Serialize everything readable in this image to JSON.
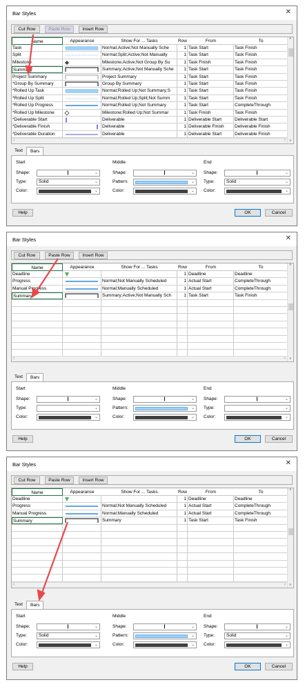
{
  "dialogs": [
    {
      "title": "Bar Styles",
      "toolbar": {
        "cut": "Cut Row",
        "paste": "Paste Row",
        "insert": "Insert Row",
        "paste_disabled": true
      },
      "headers": {
        "name": "Name",
        "appearance": "Appearance",
        "show_for": "Show For ... Tasks",
        "row": "Row",
        "from": "From",
        "to": "To"
      },
      "rows": [
        {
          "name": "Task",
          "appearance": "bar-blue",
          "show_for": "Normal;Active;Not Manually Sche",
          "row": "1",
          "from": "Task Start",
          "to": "Task Finish"
        },
        {
          "name": "Split",
          "appearance": "dotted",
          "show_for": "Normal;Split;Active;Not Manually",
          "row": "1",
          "from": "Task Start",
          "to": "Task Finish"
        },
        {
          "name": "Milestone",
          "appearance": "diamond",
          "show_for": "Milestone;Active;Not Group By Su",
          "row": "1",
          "from": "Task Finish",
          "to": "Task Finish"
        },
        {
          "name": "Summary",
          "appearance": "bracket",
          "show_for": "Summary;Active;Not Manually Sche",
          "row": "1",
          "from": "Task Start",
          "to": "Task Finish",
          "selected": true
        },
        {
          "name": "Project Summary",
          "appearance": "bracket-light",
          "show_for": "Project Summary",
          "row": "1",
          "from": "Task Start",
          "to": "Task Finish"
        },
        {
          "name": "*Group By Summary",
          "appearance": "bracket",
          "show_for": "Group By Summary",
          "row": "1",
          "from": "Task Start",
          "to": "Task Finish"
        },
        {
          "name": "*Rolled Up Task",
          "appearance": "bar-blue",
          "show_for": "Normal;Rolled Up;Not Summary;S",
          "row": "1",
          "from": "Task Start",
          "to": "Task Finish"
        },
        {
          "name": "*Rolled Up Split",
          "appearance": "dotted",
          "show_for": "Normal;Rolled Up;Split;Not Summ",
          "row": "1",
          "from": "Task Start",
          "to": "Task Finish"
        },
        {
          "name": "*Rolled Up Progress",
          "appearance": "line-blue",
          "show_for": "Normal;Rolled Up;Not Summary",
          "row": "1",
          "from": "Task Start",
          "to": "CompleteThrough"
        },
        {
          "name": "*Rolled Up Milestone",
          "appearance": "diamond-outline",
          "show_for": "Milestone;Rolled Up;Not Summar",
          "row": "1",
          "from": "Task Finish",
          "to": "Task Finish"
        },
        {
          "name": "*Deliverable Start",
          "appearance": "tick-left",
          "show_for": "Deliverable",
          "row": "1",
          "from": "Deliverable Start",
          "to": "Deliverable Start"
        },
        {
          "name": "*Deliverable Finish",
          "appearance": "tick-right",
          "show_for": "Deliverable",
          "row": "1",
          "from": "Deliverable Finish",
          "to": "Deliverable Finish"
        },
        {
          "name": "*Deliverable Duration",
          "appearance": "line-purple",
          "show_for": "Deliverable",
          "row": "1",
          "from": "Deliverable Start",
          "to": "Deliverable Finish"
        }
      ],
      "tabs": {
        "text": "Text",
        "bars": "Bars"
      },
      "start": {
        "title": "Start",
        "shape_label": "Shape:",
        "type_label": "Type:",
        "color_label": "Color:",
        "type_value": "Solid"
      },
      "middle": {
        "title": "Middle",
        "shape_label": "Shape:",
        "pattern_label": "Pattern:",
        "color_label": "Color:"
      },
      "end": {
        "title": "End",
        "shape_label": "Shape:",
        "type_label": "Type:",
        "color_label": "Color:",
        "type_value": "Solid"
      },
      "buttons": {
        "help": "Help",
        "ok": "OK",
        "cancel": "Cancel"
      }
    },
    {
      "title": "Bar Styles",
      "toolbar": {
        "cut": "Cut Row",
        "paste": "Paste Row",
        "insert": "Insert Row",
        "paste_disabled": false
      },
      "headers": {
        "name": "Name",
        "appearance": "Appearance",
        "show_for": "Show For ... Tasks",
        "row": "Row",
        "from": "From",
        "to": "To"
      },
      "rows": [
        {
          "name": "Deadline",
          "appearance": "arrow-green",
          "show_for": "",
          "row": "1",
          "from": "Deadline",
          "to": "Deadline"
        },
        {
          "name": "Progress",
          "appearance": "line-blue",
          "show_for": "Normal;Not Manually Scheduled",
          "row": "1",
          "from": "Actual Start",
          "to": "CompleteThrough"
        },
        {
          "name": "Manual Progress",
          "appearance": "line-blue",
          "show_for": "Normal;Manually Scheduled",
          "row": "1",
          "from": "Actual Start",
          "to": "CompleteThrough"
        },
        {
          "name": "Summary",
          "appearance": "bracket",
          "show_for": "Summary;Active;Not Manually Sch",
          "row": "1",
          "from": "Task Start",
          "to": "Task Finish",
          "selected": true
        }
      ],
      "tabs": {
        "text": "Text",
        "bars": "Bars"
      },
      "start": {
        "title": "Start",
        "shape_label": "Shape:",
        "type_label": "Type:",
        "color_label": "Color:",
        "type_value": ""
      },
      "middle": {
        "title": "Middle",
        "shape_label": "Shape:",
        "pattern_label": "Pattern:",
        "color_label": "Color:"
      },
      "end": {
        "title": "End",
        "shape_label": "Shape:",
        "type_label": "Type:",
        "color_label": "Color:",
        "type_value": ""
      },
      "buttons": {
        "help": "Help",
        "ok": "OK",
        "cancel": "Cancel"
      }
    },
    {
      "title": "Bar Styles",
      "toolbar": {
        "cut": "Cut Row",
        "paste": "Paste Row",
        "insert": "Insert Row",
        "paste_disabled": false
      },
      "headers": {
        "name": "Name",
        "appearance": "Appearance",
        "show_for": "Show For ... Tasks",
        "row": "Row",
        "from": "From",
        "to": "To"
      },
      "rows": [
        {
          "name": "Deadline",
          "appearance": "arrow-green",
          "show_for": "",
          "row": "1",
          "from": "Deadline",
          "to": "Deadline"
        },
        {
          "name": "Progress",
          "appearance": "line-blue",
          "show_for": "Normal;Not Manually Scheduled",
          "row": "1",
          "from": "Actual Start",
          "to": "CompleteThrough"
        },
        {
          "name": "Manual Progress",
          "appearance": "line-blue",
          "show_for": "Normal;Manually Scheduled",
          "row": "1",
          "from": "Actual Start",
          "to": "CompleteThrough"
        },
        {
          "name": "Summary",
          "appearance": "bracket",
          "show_for": "Summary",
          "row": "1",
          "from": "Task Start",
          "to": "Task Finish",
          "selected": true
        }
      ],
      "tabs": {
        "text": "Text",
        "bars": "Bars"
      },
      "start": {
        "title": "Start",
        "shape_label": "Shape:",
        "type_label": "Type:",
        "color_label": "Color:",
        "type_value": "Solid"
      },
      "middle": {
        "title": "Middle",
        "shape_label": "Shape:",
        "pattern_label": "Pattern:",
        "color_label": "Color:"
      },
      "end": {
        "title": "End",
        "shape_label": "Shape:",
        "type_label": "Type:",
        "color_label": "Color:",
        "type_value": "Solid"
      },
      "buttons": {
        "help": "Help",
        "ok": "OK",
        "cancel": "Cancel"
      }
    }
  ],
  "colors": {
    "accent_green": "#217346",
    "annotation_red": "#e8474c",
    "bar_blue": "#9fd0f5",
    "line_blue": "#2e8ad8",
    "dark_swatch": "#404040"
  }
}
